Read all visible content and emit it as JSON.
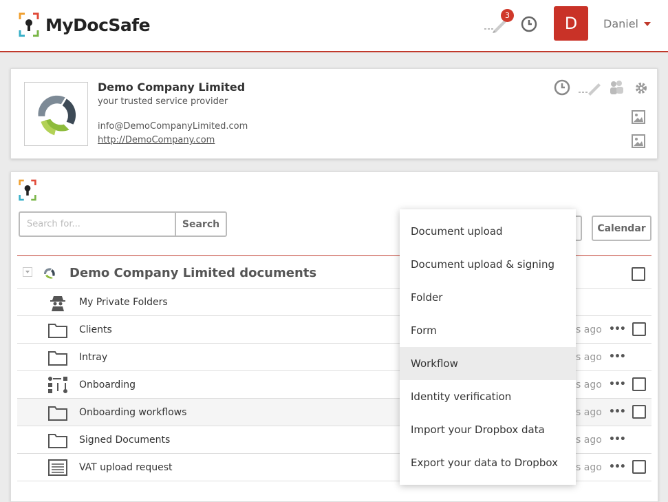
{
  "app": {
    "brand": "MyDocSafe",
    "notification_count": "3",
    "user_initial": "D",
    "user_name": "Daniel",
    "accent_color": "#c0392b"
  },
  "company": {
    "name": "Demo Company Limited",
    "tagline": "your trusted service provider",
    "email": "info@DemoCompanyLimited.com",
    "url": "http://DemoCompany.com"
  },
  "toolbar": {
    "search_placeholder": "Search for...",
    "search_label": "Search",
    "calendar_label": "Calendar"
  },
  "documents": {
    "title": "Demo Company Limited documents",
    "rows": [
      {
        "label": "My Private Folders",
        "icon": "spy-icon",
        "time": "",
        "menu": false,
        "check": false
      },
      {
        "label": "Clients",
        "icon": "folder-icon",
        "time": "s ago",
        "menu": true,
        "check": true
      },
      {
        "label": "Intray",
        "icon": "folder-icon",
        "time": "s ago",
        "menu": true,
        "check": false
      },
      {
        "label": "Onboarding",
        "icon": "workflow-icon",
        "time": "s ago",
        "menu": true,
        "check": true
      },
      {
        "label": "Onboarding workflows",
        "icon": "folder-icon",
        "time": "s ago",
        "menu": true,
        "check": true
      },
      {
        "label": "Signed Documents",
        "icon": "folder-icon",
        "time": "s ago",
        "menu": true,
        "check": false
      },
      {
        "label": "VAT upload request",
        "icon": "form-icon",
        "time": "s ago",
        "menu": true,
        "check": true
      }
    ]
  },
  "dropdown": {
    "items": [
      "Document upload",
      "Document upload & signing",
      "Folder",
      "Form",
      "Workflow",
      "Identity verification",
      "Import your Dropbox data",
      "Export your data to Dropbox"
    ],
    "active_index": 4
  }
}
